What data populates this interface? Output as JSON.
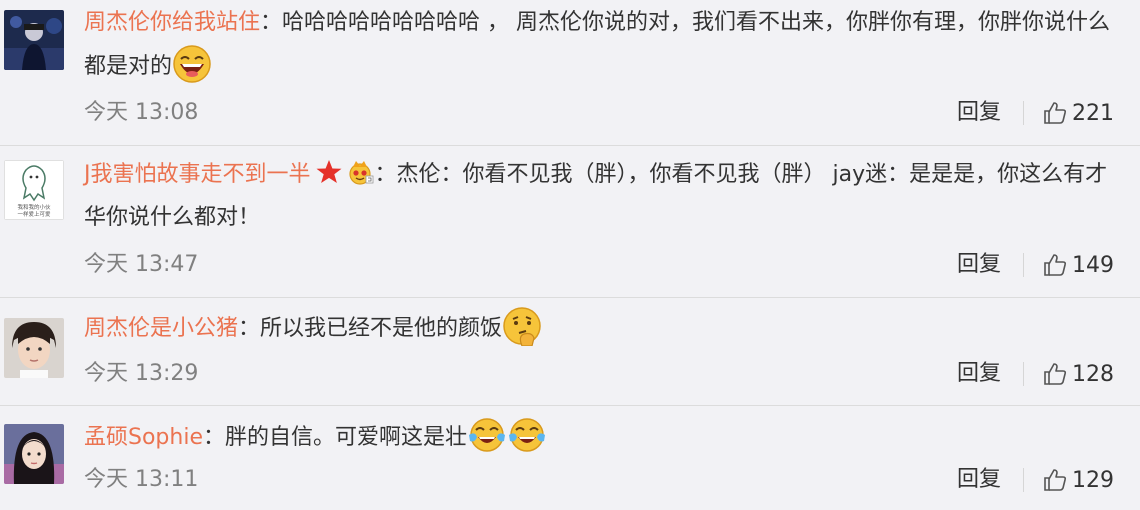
{
  "comments": [
    {
      "name": "周杰伦你给我站住",
      "colon": "：",
      "text": "哈哈哈哈哈哈哈哈哈 ， 周杰伦你说的对，我们看不出来，你胖你有理，你胖你说什么都是对的",
      "emojis": [
        "laughing-face-emoji"
      ],
      "time": "今天 13:08",
      "reply": "回复",
      "likes": "221"
    },
    {
      "name": "J我害怕故事走不到一半",
      "colon": "：",
      "text": "杰伦：你看不见我（胖），你看不见我（胖） jay迷：是是是，你这么有才华你说什么都对！",
      "badges": [
        "red-star-badge",
        "crown-member-badge"
      ],
      "avatar_text_line1": "我和我的小伙",
      "avatar_text_line2": "一样爱上可爱",
      "time": "今天 13:47",
      "reply": "回复",
      "likes": "149"
    },
    {
      "name": "周杰伦是小公猪",
      "colon": "：",
      "text": "所以我已经不是他的颜饭",
      "emojis": [
        "thinking-face-emoji"
      ],
      "time": "今天 13:29",
      "reply": "回复",
      "likes": "128"
    },
    {
      "name": "孟硕Sophie",
      "colon": "：",
      "text": "胖的自信。可爱啊这是壮",
      "emojis": [
        "tears-of-joy-emoji",
        "tears-of-joy-emoji"
      ],
      "time": "今天 13:11",
      "reply": "回复",
      "likes": "129"
    }
  ],
  "icons": {
    "like": "thumbs-up-icon"
  }
}
